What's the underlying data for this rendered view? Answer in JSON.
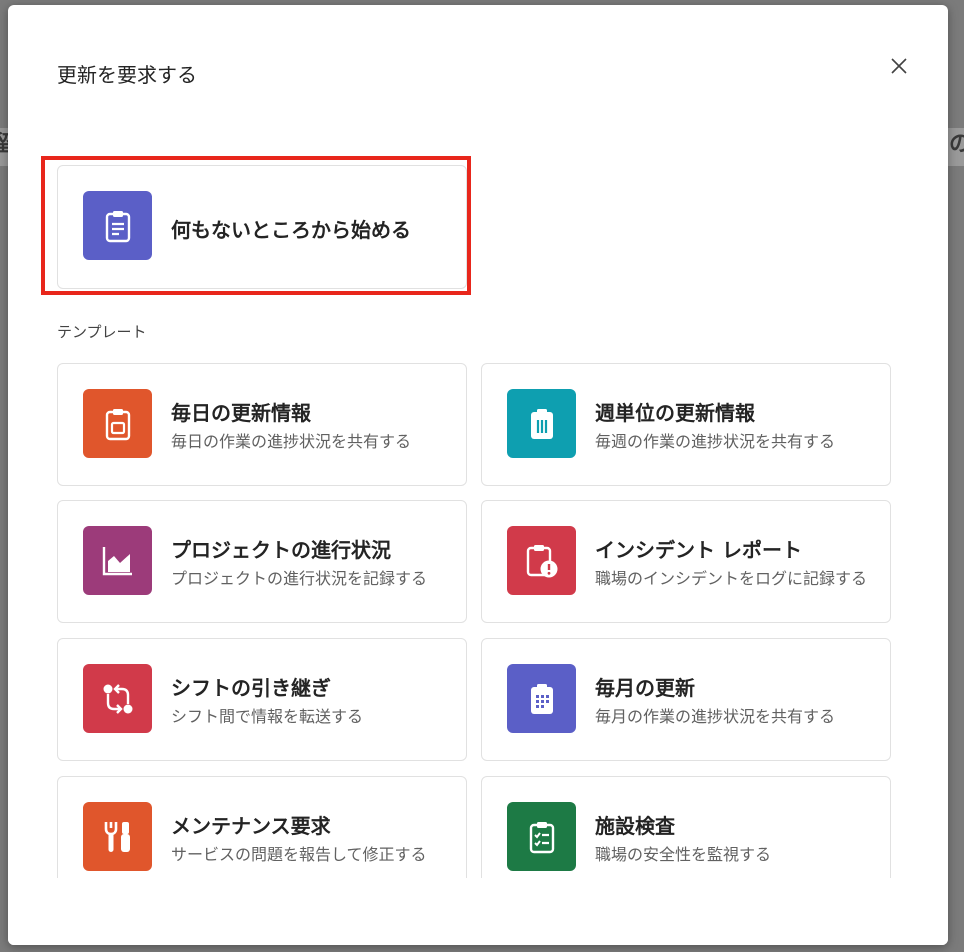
{
  "dialog": {
    "title": "更新を要求する",
    "close_icon": "close-icon",
    "blank_card": {
      "title": "何もないところから始める",
      "icon": "clipboard-icon",
      "color": "#5b5fc7"
    },
    "section_label": "テンプレート",
    "templates": [
      {
        "title": "毎日の更新情報",
        "desc": "毎日の作業の進捗状況を共有する",
        "icon": "clipboard-icon",
        "color": "#e0562c"
      },
      {
        "title": "週単位の更新情報",
        "desc": "毎週の作業の進捗状況を共有する",
        "icon": "clipboard-icon",
        "color": "#0e9fb0"
      },
      {
        "title": "プロジェクトの進行状況",
        "desc": "プロジェクトの進行状況を記録する",
        "icon": "area-chart-icon",
        "color": "#9c3b7a"
      },
      {
        "title": "インシデント レポート",
        "desc": "職場のインシデントをログに記録する",
        "icon": "clipboard-alert-icon",
        "color": "#d13a4a"
      },
      {
        "title": "シフトの引き継ぎ",
        "desc": "シフト間で情報を転送する",
        "icon": "arrows-swap-icon",
        "color": "#d13a4a"
      },
      {
        "title": "毎月の更新",
        "desc": "毎月の作業の進捗状況を共有する",
        "icon": "clipboard-calendar-icon",
        "color": "#5b5fc7"
      },
      {
        "title": "メンテナンス要求",
        "desc": "サービスの問題を報告して修正する",
        "icon": "tools-icon",
        "color": "#e0562c"
      },
      {
        "title": "施設検査",
        "desc": "職場の安全性を監視する",
        "icon": "checklist-icon",
        "color": "#1d7a45"
      }
    ]
  },
  "background": {
    "left_char": "留",
    "right_char": "の"
  }
}
